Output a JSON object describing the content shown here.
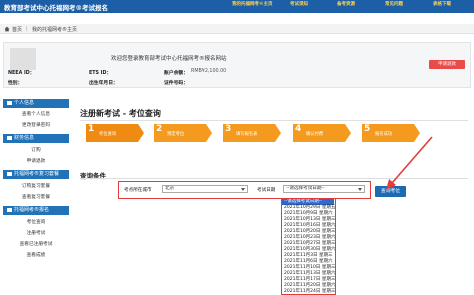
{
  "header": {
    "brand": "教育部考试中心托福网考®考试报名",
    "nav": [
      "我的托福网考®主页",
      "考试须知",
      "备考资源",
      "常见问题",
      "表格下载"
    ]
  },
  "breadcrumb": {
    "home": "首页",
    "current": "我的托福网考®主页"
  },
  "profile": {
    "welcome": "欢迎您登录教育部考试中心托福网考®报名网站",
    "neea_label": "NEEA ID：",
    "ets_label": "ETS ID：",
    "balance_label": "账户余额：",
    "balance_value": "RMB¥2,100.00",
    "name_label": "姓名：",
    "gender_label": "性别：",
    "dob_label": "出生年月日：",
    "id_label": "证件号码：",
    "charge_button": "申请退款"
  },
  "sidebar": {
    "sections": [
      {
        "title": "个人信息",
        "items": [
          "查看个人信息",
          "更改登录密码"
        ]
      },
      {
        "title": "财务信息",
        "items": [
          "订购",
          "申请退款"
        ]
      },
      {
        "title": "托福网考®复习套餐",
        "items": [
          "订购复习套餐",
          "查看复习套餐"
        ]
      },
      {
        "title": "托福网考®报名",
        "items": [
          "考位查询",
          "注册考试",
          "查看已注册考试",
          "查看成绩"
        ]
      }
    ]
  },
  "page": {
    "title": "注册新考试 - 考位查询",
    "query_title": "查询条件"
  },
  "steps": [
    {
      "num": "1",
      "label": "考位查询"
    },
    {
      "num": "2",
      "label": "预定考位"
    },
    {
      "num": "3",
      "label": "填写报名表"
    },
    {
      "num": "4",
      "label": "确认付费"
    },
    {
      "num": "5",
      "label": "报名成功"
    }
  ],
  "query": {
    "city_label": "考点所在城市",
    "city_value": "北京",
    "date_label": "考试日期",
    "date_value": "--请选择考试日期--",
    "search_button": "查询考位"
  },
  "date_options": [
    "--请选择考试日期--",
    "2021年10月29日 星期五",
    "2021年10月9日 星期六",
    "2021年10月13日 星期三",
    "2021年10月16日 星期六",
    "2021年10月20日 星期三",
    "2021年10月23日 星期六",
    "2021年10月27日 星期三",
    "2021年10月30日 星期六",
    "2021年11月3日 星期三",
    "2021年11月6日 星期六",
    "2021年11月10日 星期三",
    "2021年11月13日 星期六",
    "2021年11月17日 星期三",
    "2021年11月20日 星期六",
    "2021年11月24日 星期三"
  ],
  "colors": {
    "header": "#1c5fa6",
    "accent": "#ef8b12",
    "highlight": "#e23b3b",
    "button": "#1c69b4"
  }
}
